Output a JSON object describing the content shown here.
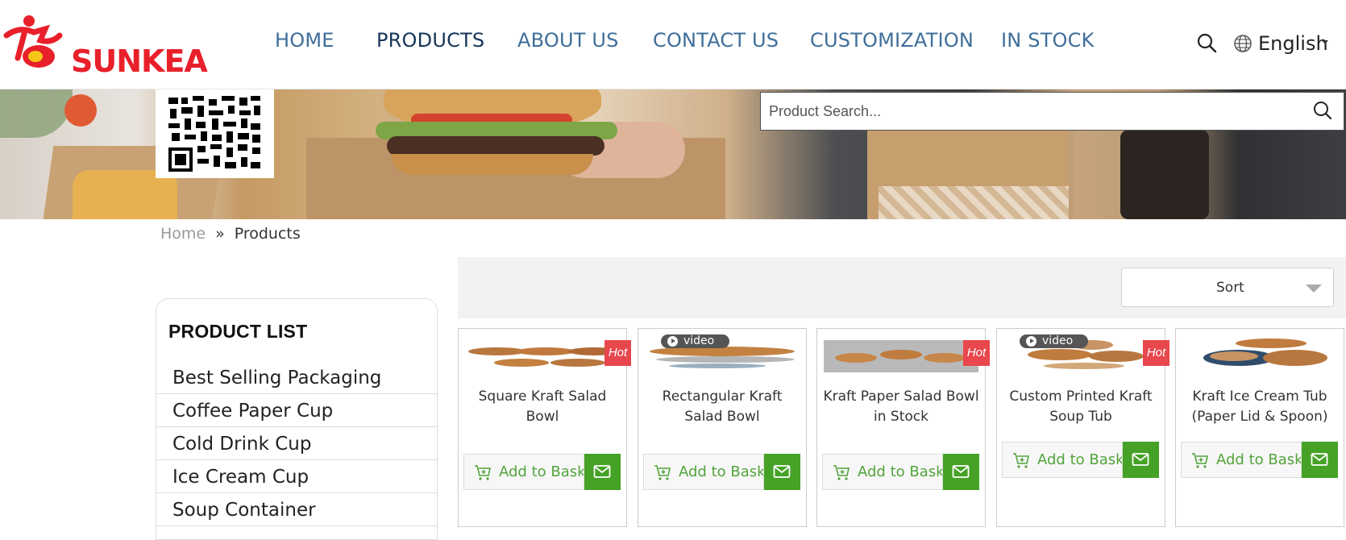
{
  "brand": {
    "logo_text": "SUNKEA",
    "color": "#e8202a"
  },
  "nav": {
    "items": [
      {
        "label": "HOME",
        "active": false
      },
      {
        "label": "PRODUCTS",
        "active": true
      },
      {
        "label": "ABOUT US",
        "active": false
      },
      {
        "label": "CONTACT US",
        "active": false
      },
      {
        "label": "CUSTOMIZATION",
        "active": false
      },
      {
        "label": "IN STOCK",
        "active": false
      }
    ],
    "language": "English"
  },
  "search": {
    "placeholder": "Product Search..."
  },
  "breadcrumb": {
    "home": "Home",
    "separator": "»",
    "current": "Products"
  },
  "sidebar": {
    "title": "PRODUCT LIST",
    "items": [
      "Best Selling Packaging",
      "Coffee Paper Cup",
      "Cold Drink Cup",
      "Ice Cream Cup",
      "Soup Container"
    ]
  },
  "sort": {
    "label": "Sort"
  },
  "products": [
    {
      "name": "Square Kraft Salad Bowl",
      "hot": "Hot",
      "video": null,
      "add_label": "Add to Basket"
    },
    {
      "name": "Rectangular Kraft Salad Bowl",
      "hot": null,
      "video": "video",
      "add_label": "Add to Basket"
    },
    {
      "name": "Kraft Paper Salad Bowl in Stock",
      "hot": "Hot",
      "video": null,
      "add_label": "Add to Basket"
    },
    {
      "name": "Custom Printed Kraft Soup Tub",
      "hot": "Hot",
      "video": "video",
      "add_label": "Add to Basket"
    },
    {
      "name": "Kraft Ice Cream Tub (Paper Lid & Spoon)",
      "hot": null,
      "video": null,
      "add_label": "Add to Basket"
    }
  ],
  "colors": {
    "accent_green": "#45a226",
    "hot_red": "#e8474d",
    "nav_blue": "#3f6e9a"
  }
}
